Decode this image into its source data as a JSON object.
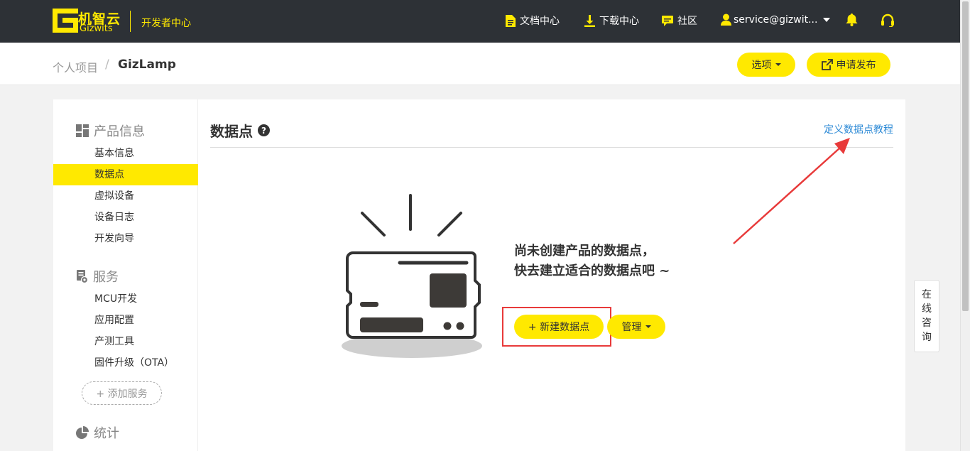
{
  "nav": {
    "logo_cn": "机智云",
    "logo_en": "Gizwits",
    "dev_center": "开发者中心",
    "docs": "文档中心",
    "download": "下载中心",
    "community": "社区",
    "user": "service@gizwit...",
    "icons": [
      "doc-icon",
      "download-icon",
      "chat-icon",
      "user-icon",
      "bell-icon",
      "headset-icon"
    ]
  },
  "header": {
    "crumb_root": "个人项目",
    "crumb_sep": "/",
    "crumb_current": "GizLamp",
    "options_label": "选项",
    "publish_label": "申请发布"
  },
  "sidebar": {
    "sections": [
      {
        "title": "产品信息",
        "icon": "grid-icon",
        "items": [
          "基本信息",
          "数据点",
          "虚拟设备",
          "设备日志",
          "开发向导"
        ]
      },
      {
        "title": "服务",
        "icon": "service-icon",
        "items": [
          "MCU开发",
          "应用配置",
          "产测工具",
          "固件升级（OTA）"
        ]
      },
      {
        "title": "统计",
        "icon": "pie-icon",
        "items": []
      }
    ],
    "active_item": "数据点",
    "add_service": "+ 添加服务"
  },
  "main": {
    "title": "数据点",
    "tutorial_link": "定义数据点教程",
    "empty_line1": "尚未创建产品的数据点，",
    "empty_line2": "快去建立适合的数据点吧 ~",
    "new_button": "+ 新建数据点",
    "manage_button": "管理"
  },
  "float": {
    "consult": [
      "在",
      "线",
      "咨",
      "询"
    ]
  },
  "colors": {
    "brand_yellow": "#ffe900",
    "nav_bg": "#2d3136",
    "link_blue": "#2d8ad6",
    "annotation_red": "#e83a3a"
  }
}
